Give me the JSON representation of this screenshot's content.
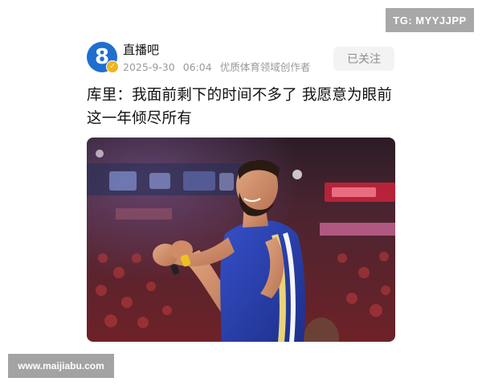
{
  "watermarks": {
    "top": "TG: MYYJJPP",
    "bottom": "www.maijiabu.com"
  },
  "post": {
    "account": {
      "name": "直播吧",
      "avatar_glyph": "8",
      "avatar_color": "#1f6fd1"
    },
    "date": "2025-9-30",
    "time": "06:04",
    "author_tag": "优质体育领域创作者",
    "follow_label": "已关注",
    "headline_line1": "库里：我面前剩下的时间不多了 我愿意为眼前",
    "headline_line2": "这一年倾尽所有"
  },
  "colors": {
    "jersey": "#2a3fae",
    "arena_red": "#b3262c"
  }
}
